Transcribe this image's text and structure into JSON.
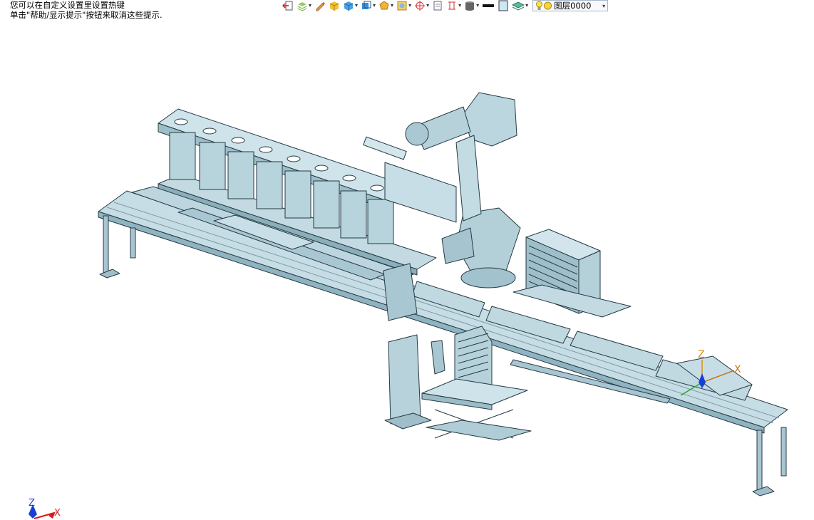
{
  "hint": {
    "line1": "您可以在自定义设置里设置热键",
    "line2": "单击\"帮助/显示提示\"按钮来取消这些提示."
  },
  "toolbar": {
    "icons": [
      "exit-sketch-icon",
      "layers-icon",
      "pencil-icon",
      "solid-box-icon",
      "cube-icon",
      "view-cube-icon",
      "render-mode-icon",
      "material-icon",
      "snap-target-icon",
      "sheet-icon",
      "frame-icon",
      "cylinder-icon",
      "line-color-icon",
      "fill-color-icon",
      "layer-stack-icon"
    ],
    "layer": {
      "label": "图层0000"
    }
  },
  "model_triad": {
    "z": "Z",
    "x": "X"
  },
  "corner_triad": {
    "z": "Z",
    "x": "X"
  },
  "colors": {
    "model_fill": "#b9d4dd",
    "model_edge": "#253a44",
    "axis_z": "#e08c1a",
    "axis_x": "#c8751a",
    "axis_blue": "#1540d8",
    "axis_red": "#d41b1b"
  }
}
